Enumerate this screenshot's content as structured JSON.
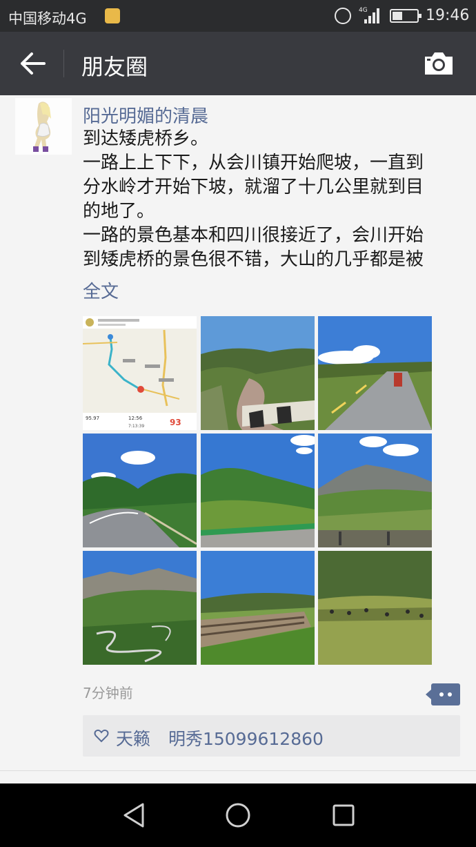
{
  "status_bar": {
    "carrier": "中国移动4G",
    "network_badge": "4G",
    "time": "19:46"
  },
  "header": {
    "title": "朋友圈"
  },
  "post": {
    "author": "阳光明媚的清晨",
    "text_lines": [
      "到达矮虎桥乡。",
      "一路上上下下，从会川镇开始爬坡，一直到",
      "分水岭才开始下坡，就溜了十几公里就到目",
      "的地了。",
      "一路的景色基本和四川很接近了，会川开始",
      "到矮虎桥的景色很不错，大山的几乎都是被"
    ],
    "expand_link": "全文",
    "time_ago": "7分钟前",
    "likes": [
      "天籁",
      "明秀15099612860"
    ],
    "map_card": {
      "stat_1": "95.97",
      "stat_2": "12:56",
      "stat_3": "7:13:39",
      "score": "93"
    }
  },
  "icons": {
    "back": "arrow-left-icon",
    "camera": "camera-icon",
    "comment": "comment-dots-icon",
    "like": "heart-outline-icon",
    "nav_back": "triangle-back-icon",
    "nav_home": "circle-home-icon",
    "nav_recent": "square-recents-icon"
  },
  "colors": {
    "link_blue": "#576b95",
    "title_bar": "#393a3f",
    "status_bar": "#2b2c2e"
  }
}
